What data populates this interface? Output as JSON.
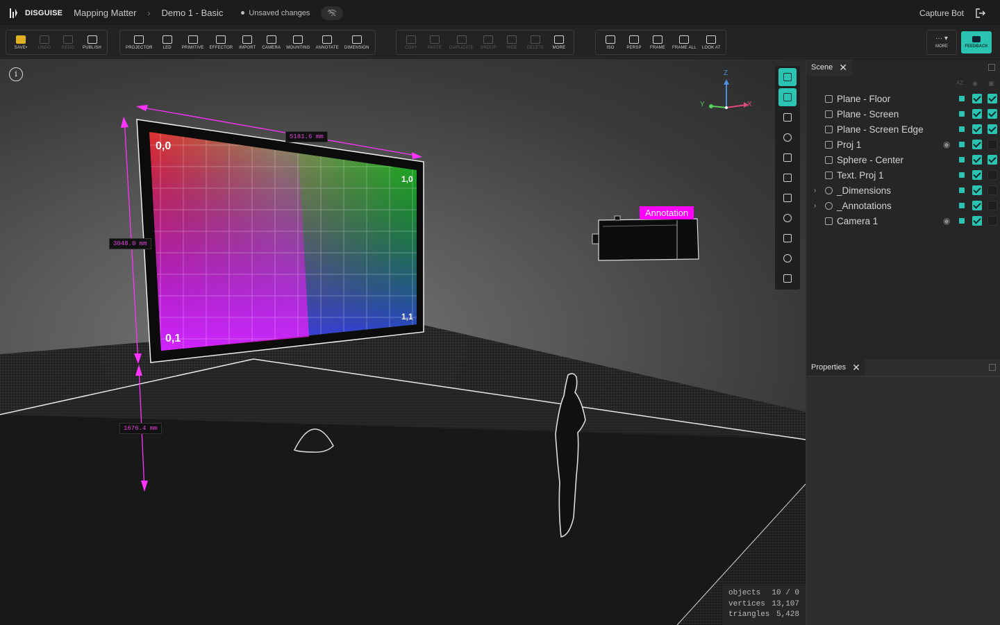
{
  "header": {
    "brand": "DISGUISE",
    "project": "Mapping Matter",
    "file": "Demo 1 - Basic",
    "status": "Unsaved changes",
    "user": "Capture Bot"
  },
  "toolbar": {
    "group1": [
      {
        "label": "SAVE•",
        "icon": "save-icon",
        "enabled": true
      },
      {
        "label": "UNDO",
        "icon": "undo-icon",
        "enabled": false
      },
      {
        "label": "REDO",
        "icon": "redo-icon",
        "enabled": false
      },
      {
        "label": "PUBLISH",
        "icon": "publish-icon",
        "enabled": true
      }
    ],
    "group2": [
      {
        "label": "PROJECTOR",
        "icon": "projector-icon"
      },
      {
        "label": "LED",
        "icon": "led-icon"
      },
      {
        "label": "PRIMITIVE",
        "icon": "primitive-icon"
      },
      {
        "label": "EFFECTOR",
        "icon": "effector-icon"
      },
      {
        "label": "IMPORT",
        "icon": "import-icon"
      },
      {
        "label": "CAMERA",
        "icon": "camera-icon"
      },
      {
        "label": "MOUNTING",
        "icon": "mounting-icon"
      },
      {
        "label": "ANNOTATE",
        "icon": "annotate-icon"
      },
      {
        "label": "DIMENSION",
        "icon": "dimension-icon"
      }
    ],
    "group3": [
      {
        "label": "COPY",
        "icon": "copy-icon"
      },
      {
        "label": "PASTE",
        "icon": "paste-icon"
      },
      {
        "label": "DUPLICATE",
        "icon": "duplicate-icon"
      },
      {
        "label": "GROUP",
        "icon": "group-icon"
      },
      {
        "label": "HIDE",
        "icon": "hide-icon"
      },
      {
        "label": "DELETE",
        "icon": "delete-icon"
      },
      {
        "label": "MORE",
        "icon": "more-icon",
        "enabled": true
      }
    ],
    "group4": [
      {
        "label": "ISO",
        "icon": "iso-icon"
      },
      {
        "label": "PERSP",
        "icon": "persp-icon"
      },
      {
        "label": "FRAME",
        "icon": "frame-icon"
      },
      {
        "label": "FRAME ALL",
        "icon": "frame-all-icon"
      },
      {
        "label": "LOOK AT",
        "icon": "look-at-icon"
      }
    ],
    "more_label": "MORE",
    "feedback_label": "FEEDBACK"
  },
  "viewport": {
    "dimensions": {
      "width": "5181.6 mm",
      "height": "3048.0 mm",
      "elevation": "1676.4 mm"
    },
    "grid_labels": {
      "top_left": "0,0",
      "top_right": "1,0",
      "bottom_left": "0,1",
      "bottom_right": "1,1"
    },
    "annotation": "Annotation",
    "axes": {
      "z": "Z",
      "y": "Y",
      "x": "X"
    },
    "stats": [
      {
        "label": "objects",
        "value": "10 / 0"
      },
      {
        "label": "vertices",
        "value": "13,107"
      },
      {
        "label": "triangles",
        "value": "5,428"
      }
    ]
  },
  "panel": {
    "scene_tab": "Scene",
    "properties_tab": "Properties",
    "sort_label": "AZ",
    "tree": [
      {
        "name": "Plane - Floor",
        "icon": "mesh-icon",
        "caret": false,
        "eye": false,
        "c1": true,
        "c2": true
      },
      {
        "name": "Plane - Screen",
        "icon": "mesh-icon",
        "caret": false,
        "eye": false,
        "c1": true,
        "c2": true
      },
      {
        "name": "Plane - Screen Edge",
        "icon": "mesh-icon",
        "caret": false,
        "eye": false,
        "c1": true,
        "c2": true
      },
      {
        "name": "Proj 1",
        "icon": "projector-icon",
        "caret": false,
        "eye": true,
        "c1": true,
        "c2": false
      },
      {
        "name": "Sphere - Center",
        "icon": "mesh-icon",
        "caret": false,
        "eye": false,
        "c1": true,
        "c2": true
      },
      {
        "name": "Text. Proj 1",
        "icon": "mesh-icon",
        "caret": false,
        "eye": false,
        "c1": true,
        "c2": false
      },
      {
        "name": "_Dimensions",
        "icon": "group-icon",
        "caret": true,
        "eye": false,
        "c1": true,
        "c2": false
      },
      {
        "name": "_Annotations",
        "icon": "group-icon",
        "caret": true,
        "eye": false,
        "c1": true,
        "c2": false
      },
      {
        "name": "Camera 1",
        "icon": "camera-icon",
        "caret": false,
        "eye": true,
        "c1": true,
        "c2": false
      }
    ]
  },
  "colors": {
    "accent": "#2bc4b2",
    "dimension": "#ff33ff",
    "annotation": "#ff00ff",
    "save": "#e0b020"
  }
}
